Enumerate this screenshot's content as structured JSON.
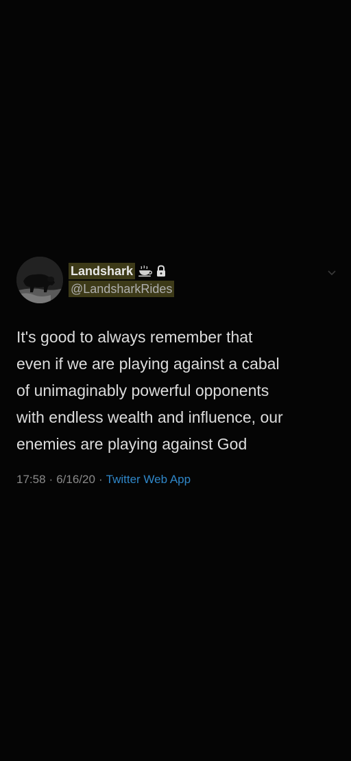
{
  "tweet": {
    "display_name": "Landshark",
    "badges": [
      "coffee-icon",
      "lock-icon"
    ],
    "handle": "@LandsharkRides",
    "text": "It's good to always remember that\neven if we are playing against a cabal\nof unimaginably powerful opponents\nwith endless wealth and influence, our\nenemies are playing against God",
    "time": "17:58",
    "date": "6/16/20",
    "separator": "·",
    "source": "Twitter Web App"
  },
  "colors": {
    "background": "#050505",
    "highlight": "#3d3a18",
    "source_link": "#2f87c9"
  }
}
